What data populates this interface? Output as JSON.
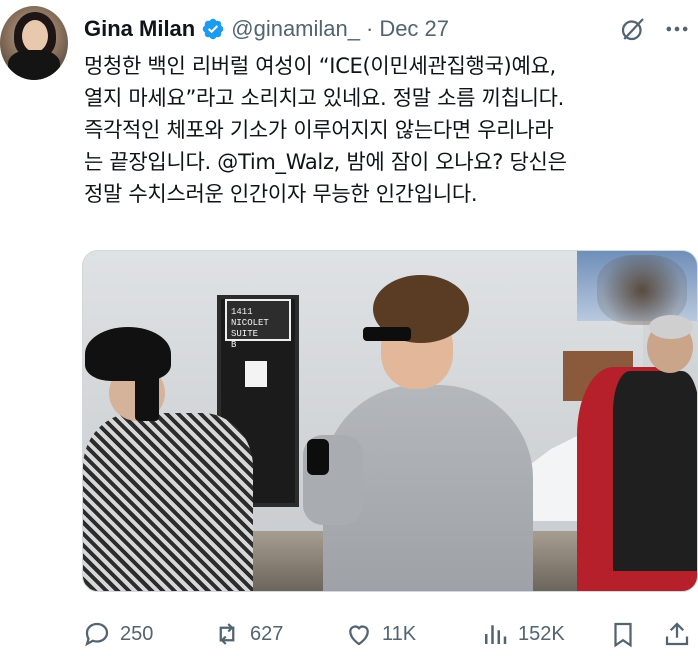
{
  "tweet": {
    "author_name": "Gina Milan",
    "handle": "@ginamilan_",
    "separator": "·",
    "date": "Dec 27",
    "text": "멍청한 백인 리버럴 여성이 “ICE(이민세관집행국)예요,\n열지 마세요”라고 소리치고 있네요. 정말 소름 끼칩니다.\n즉각적인 체포와 기소가 이루어지지 않는다면 우리나라\n는 끝장입니다. @Tim_Walz, 밤에 잠이 오나요? 당신은\n정말 수치스러운 인간이자 무능한 인간입니다.",
    "media": {
      "sign_lines": [
        "1411 NICOLET",
        "SUITE",
        "B"
      ]
    },
    "actions": {
      "replies": "250",
      "reposts": "627",
      "likes": "11K",
      "views": "152K"
    }
  },
  "icons": {
    "verified": "verified-badge-icon",
    "grok": "grok-icon",
    "more": "more-icon",
    "reply": "reply-icon",
    "repost": "repost-icon",
    "like": "heart-icon",
    "views": "views-icon",
    "bookmark": "bookmark-icon",
    "share": "share-icon"
  },
  "colors": {
    "text": "#0f1419",
    "muted": "#536471",
    "verified": "#1d9bf0"
  }
}
